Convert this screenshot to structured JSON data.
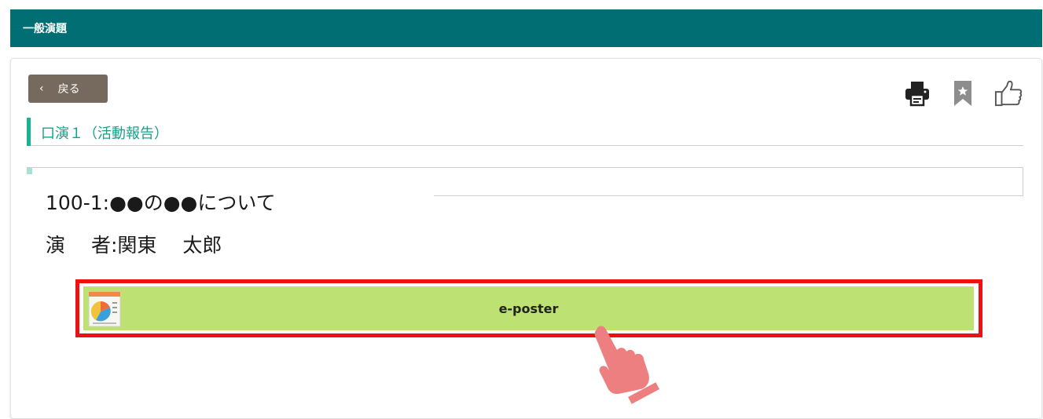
{
  "header": {
    "title": "一般演題"
  },
  "toolbar": {
    "back_label": "戻る",
    "icons": [
      "print-icon",
      "bookmark-icon",
      "thumbs-up-icon"
    ]
  },
  "section": {
    "title": "口演１（活動報告）"
  },
  "presentation": {
    "title": "100-1:●●の●●について",
    "presenter": "演　 者:関東　 太郎"
  },
  "poster": {
    "label": "e-poster"
  },
  "colors": {
    "header_bg": "#006e73",
    "accent": "#19b394",
    "back_button": "#766a5f",
    "poster_button": "#bee173",
    "highlight_border": "#ee1111",
    "pointer_hand": "#ee7f80"
  }
}
